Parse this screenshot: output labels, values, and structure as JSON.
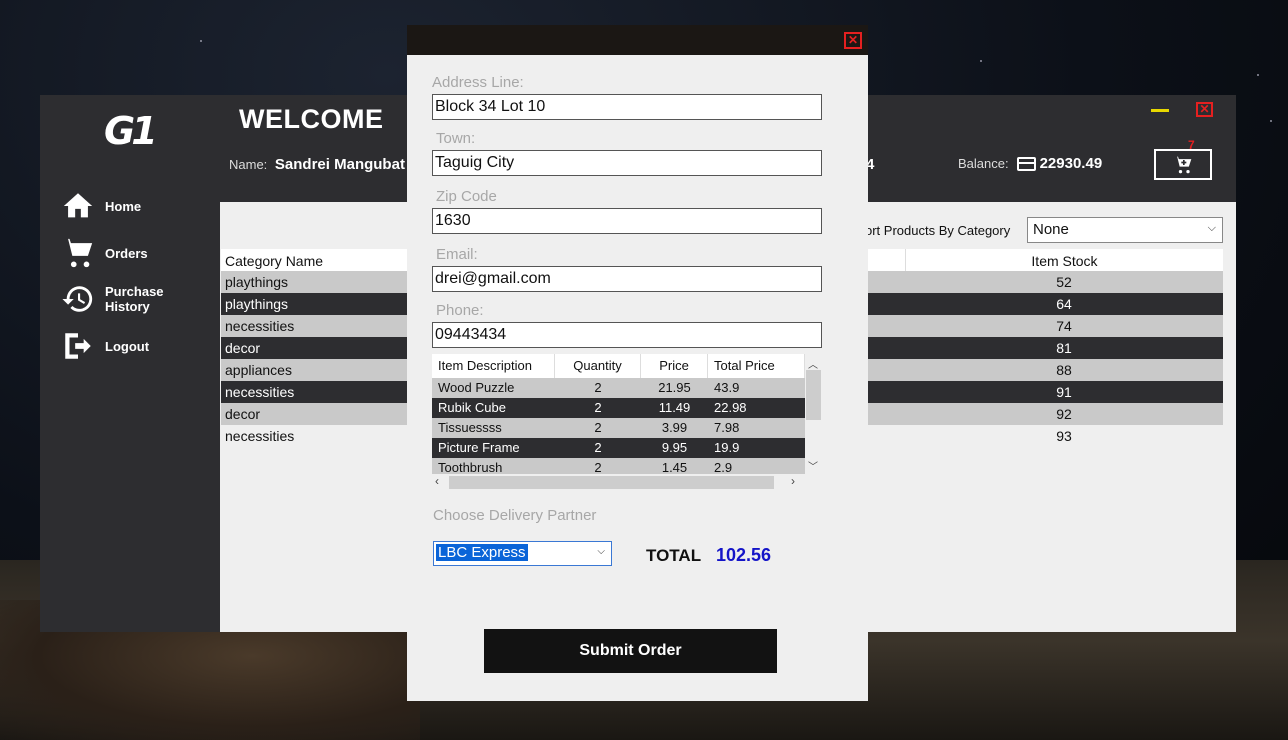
{
  "app": {
    "welcome": "WELCOME",
    "name_label": "Name:",
    "name_value": "Sandrei Mangubat",
    "hidden_value_tail": "4",
    "balance_label": "Balance:",
    "balance_value": "22930.49",
    "cart_count": "7"
  },
  "sidebar": {
    "items": [
      {
        "label": "Home",
        "icon": "home-icon"
      },
      {
        "label": "Orders",
        "icon": "cart-icon"
      },
      {
        "label": "Purchase History",
        "icon": "history-icon"
      },
      {
        "label": "Logout",
        "icon": "logout-icon"
      }
    ]
  },
  "products": {
    "sort_label": "ort Products By Category",
    "sort_value": "None",
    "columns": [
      "Category Name",
      "Item Stock"
    ],
    "rows": [
      {
        "category": "playthings",
        "stock": "52"
      },
      {
        "category": "playthings",
        "stock": "64"
      },
      {
        "category": "necessities",
        "stock": "74"
      },
      {
        "category": "decor",
        "stock": "81"
      },
      {
        "category": "appliances",
        "stock": "88"
      },
      {
        "category": "necessities",
        "stock": "91"
      },
      {
        "category": "decor",
        "stock": "92"
      },
      {
        "category": "necessities",
        "stock": "93"
      }
    ]
  },
  "checkout": {
    "address_label": "Address Line:",
    "address_value": "Block 34 Lot 10",
    "town_label": "Town:",
    "town_value": "Taguig City",
    "zip_label": "Zip Code",
    "zip_value": "1630",
    "email_label": "Email:",
    "email_value": "drei@gmail.com",
    "phone_label": "Phone:",
    "phone_value": "09443434",
    "order_columns": [
      "Item Description",
      "Quantity",
      "Price",
      "Total Price"
    ],
    "order_items": [
      {
        "desc": "Wood Puzzle",
        "qty": "2",
        "price": "21.95",
        "total": "43.9"
      },
      {
        "desc": "Rubik Cube",
        "qty": "2",
        "price": "11.49",
        "total": "22.98"
      },
      {
        "desc": "Tissuessss",
        "qty": "2",
        "price": "3.99",
        "total": "7.98"
      },
      {
        "desc": "Picture Frame",
        "qty": "2",
        "price": "9.95",
        "total": "19.9"
      },
      {
        "desc": "Toothbrush",
        "qty": "2",
        "price": "1.45",
        "total": "2.9"
      }
    ],
    "delivery_label": "Choose Delivery Partner",
    "delivery_value": "LBC Express",
    "total_label": "TOTAL",
    "total_value": "102.56",
    "submit_label": "Submit Order"
  },
  "colors": {
    "accent_close": "#e52020",
    "minimize": "#e8d800",
    "total": "#1414c8",
    "dark_row": "#2d2d30"
  }
}
